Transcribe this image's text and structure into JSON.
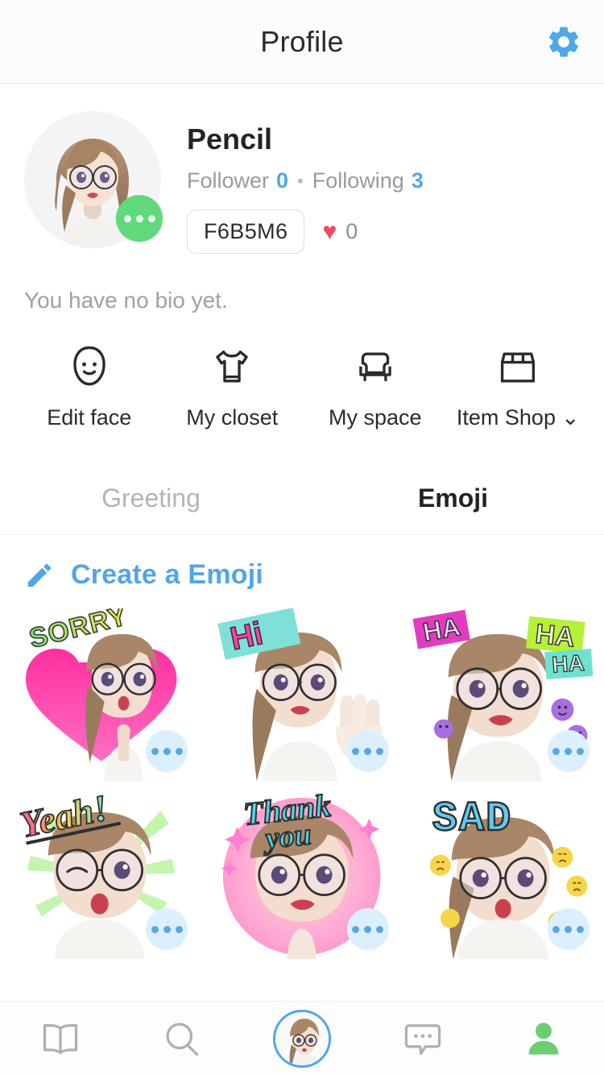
{
  "header": {
    "title": "Profile",
    "settings_icon": "gear-icon"
  },
  "profile": {
    "avatar_icon": "avatar-image",
    "avatar_badge_icon": "more-options-icon",
    "name": "Pencil",
    "follower_label": "Follower",
    "follower_count": "0",
    "separator": "•",
    "following_label": "Following",
    "following_count": "3",
    "user_id": "F6B5M6",
    "heart_icon": "♥",
    "like_count": "0",
    "bio": "You have no bio yet."
  },
  "quick_menu": [
    {
      "label": "Edit face",
      "icon": "face-icon",
      "chevron": ""
    },
    {
      "label": "My closet",
      "icon": "tshirt-icon",
      "chevron": ""
    },
    {
      "label": "My space",
      "icon": "armchair-icon",
      "chevron": ""
    },
    {
      "label": "Item Shop",
      "icon": "shop-icon",
      "chevron": "⌄"
    }
  ],
  "tabs": [
    {
      "label": "Greeting",
      "active": false
    },
    {
      "label": "Emoji",
      "active": true
    }
  ],
  "create": {
    "icon": "pencil-icon",
    "label": "Create a Emoji"
  },
  "emoji_grid": [
    {
      "caption": "SORRY",
      "more_icon": "more-options-icon"
    },
    {
      "caption": "Hi",
      "more_icon": "more-options-icon"
    },
    {
      "caption": "HA HA HA",
      "more_icon": "more-options-icon"
    },
    {
      "caption": "Yeah!",
      "more_icon": "more-options-icon"
    },
    {
      "caption": "Thank you",
      "more_icon": "more-options-icon"
    },
    {
      "caption": "SAD",
      "more_icon": "more-options-icon"
    }
  ],
  "bottom_nav": [
    {
      "icon": "book-icon",
      "active": false
    },
    {
      "icon": "search-icon",
      "active": false
    },
    {
      "icon": "avatar-icon",
      "active": true
    },
    {
      "icon": "chat-icon",
      "active": false
    },
    {
      "icon": "person-icon",
      "active": false
    }
  ],
  "colors": {
    "accent_blue": "#4fa8e8",
    "badge_green": "#5fd97a",
    "heart_red": "#ef4a5e",
    "text_dark": "#232326",
    "text_muted": "#9a9a9e",
    "nav_person_green": "#6cce74"
  }
}
